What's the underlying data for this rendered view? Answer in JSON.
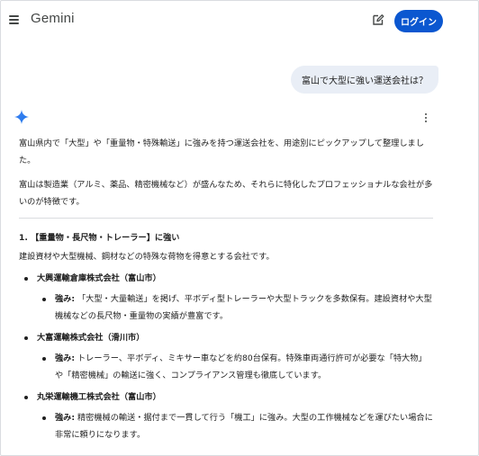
{
  "header": {
    "brand": "Gemini",
    "login_label": "ログイン"
  },
  "user_message": "富山で大型に強い運送会社は？",
  "response": {
    "intro1": "富山県内で「大型」や「重量物・特殊輸送」に強みを持つ運送会社を、用途別にピックアップして整理しました。",
    "intro2": "富山は製造業（アルミ、薬品、精密機械など）が盛んなため、それらに特化したプロフェッショナルな会社が多いのが特徴です。",
    "section1": {
      "heading": "1. 【重量物・長尺物・トレーラー】に強い",
      "intro": "建設資材や大型機械、鋼材などの特殊な荷物を得意とする会社です。",
      "companies": [
        {
          "name": "大興運輸倉庫株式会社（富山市）",
          "strength_label": "強み:",
          "strength_text": "「大型・大量輸送」を掲げ、平ボディ型トレーラーや大型トラックを多数保有。建設資材や大型機械などの長尺物・重量物の実績が豊富です。"
        },
        {
          "name": "大富運輸株式会社（滑川市）",
          "strength_label": "強み:",
          "strength_text": "トレーラー、平ボディ、ミキサー車などを約80台保有。特殊車両通行許可が必要な「特大物」や「精密機械」の輸送に強く、コンプライアンス管理も徹底しています。"
        },
        {
          "name": "丸栄運輸機工株式会社（富山市）",
          "strength_label": "強み:",
          "strength_text": "精密機械の輸送・据付まで一貫して行う「機工」に強み。大型の工作機械などを運びたい場合に非常に頼りになります。"
        }
      ]
    }
  },
  "icons": {
    "menu": "menu-icon",
    "edit": "edit-icon",
    "sparkle": "gemini-sparkle-icon",
    "more": "more-vert-icon"
  },
  "colors": {
    "accent": "#0b57d0",
    "bubble": "#e9eef6"
  }
}
